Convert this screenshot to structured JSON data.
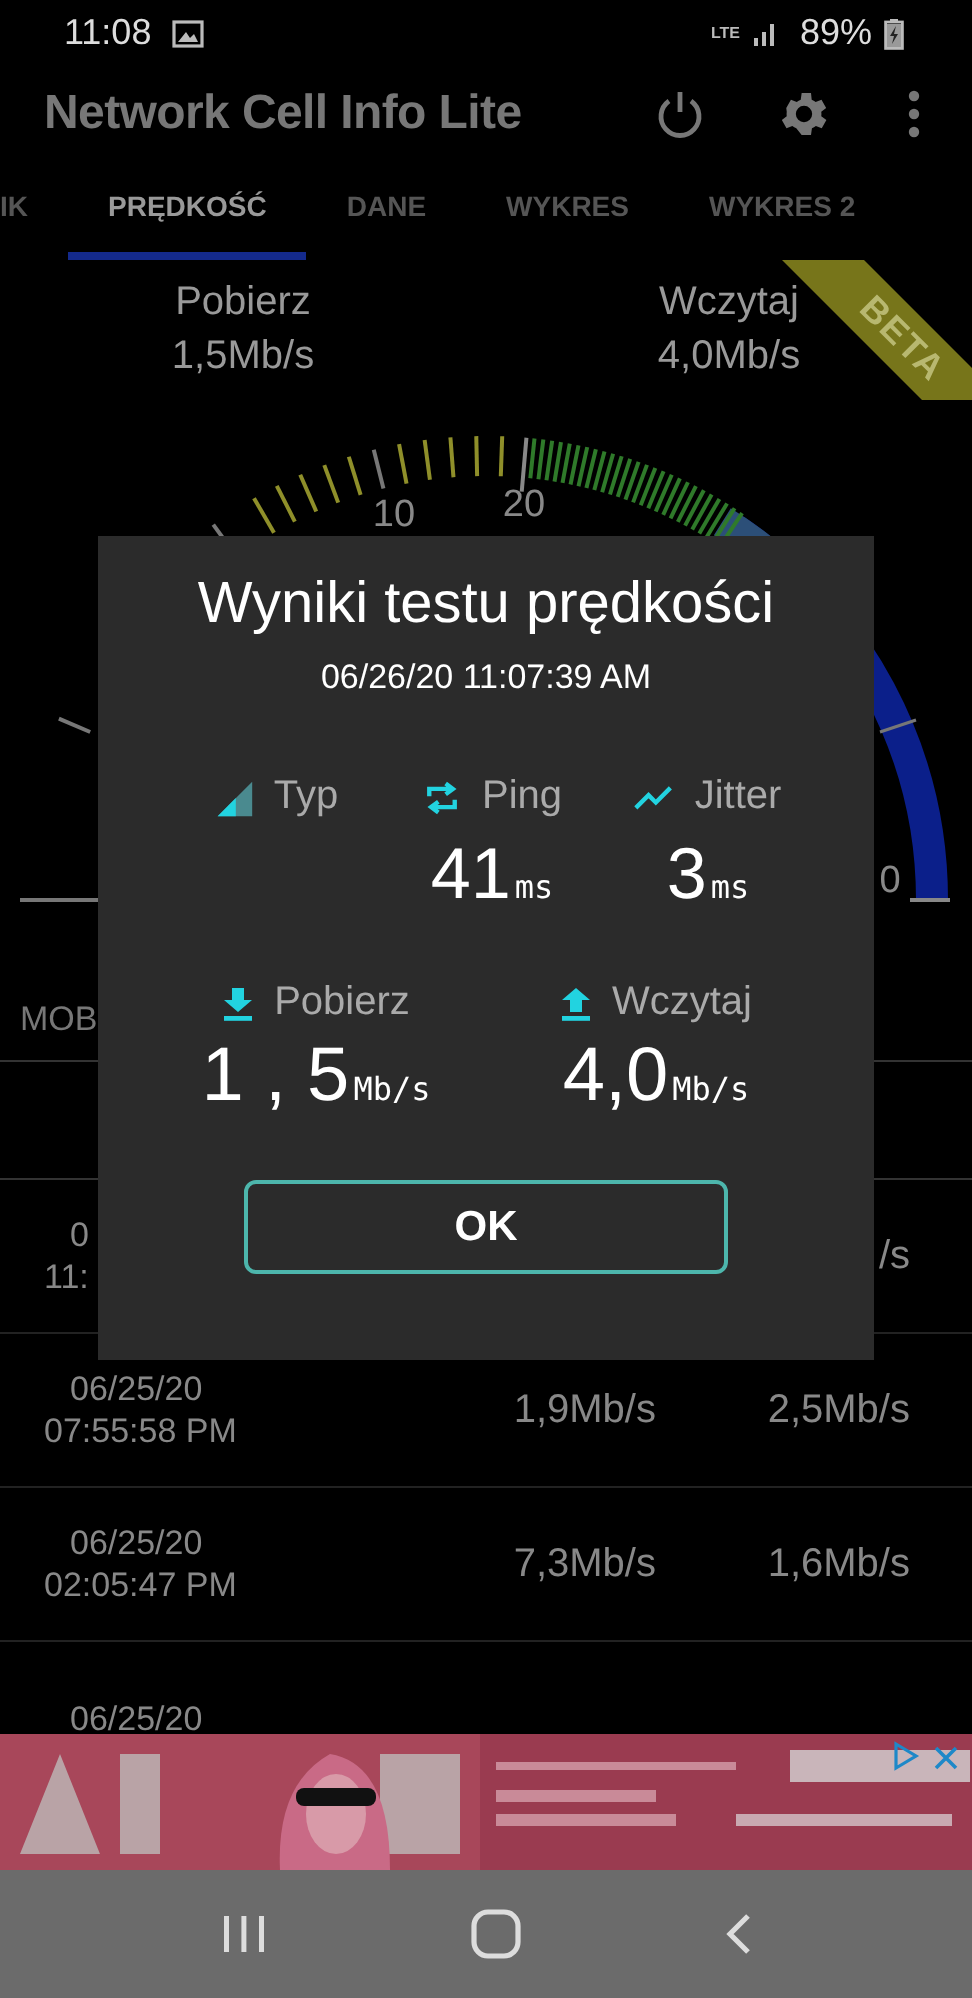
{
  "status_bar": {
    "time": "11:08",
    "network": "LTE",
    "battery": "89%"
  },
  "app_bar": {
    "title": "Network Cell Info Lite"
  },
  "tabs": [
    {
      "label": "IK",
      "selected": false
    },
    {
      "label": "PRĘDKOŚĆ",
      "selected": true
    },
    {
      "label": "DANE",
      "selected": false
    },
    {
      "label": "WYKRES",
      "selected": false
    },
    {
      "label": "WYKRES 2",
      "selected": false
    }
  ],
  "summary": {
    "ribbon": "BETA",
    "items": [
      {
        "label": "Pobierz",
        "value": "1,5Mb/s"
      },
      {
        "label": "Wczytaj",
        "value": "4,0Mb/s"
      }
    ]
  },
  "gauge": {
    "labels": [
      "10",
      "20",
      "0"
    ]
  },
  "section_label": "MOB",
  "history": {
    "rows": [
      {
        "date": "0",
        "time": "11:",
        "upload": "/s"
      },
      {
        "date": "06/25/20",
        "time": "07:55:58 PM",
        "download": "1,9Mb/s",
        "upload": "2,5Mb/s"
      },
      {
        "date": "06/25/20",
        "time": "02:05:47 PM",
        "download": "7,3Mb/s",
        "upload": "1,6Mb/s"
      },
      {
        "date": "06/25/20"
      }
    ]
  },
  "dialog": {
    "title": "Wyniki testu prędkości",
    "timestamp": "06/26/20 11:07:39 AM",
    "metrics": [
      {
        "kind": "network-type",
        "label": "Typ"
      },
      {
        "kind": "ping",
        "label": "Ping",
        "value": "41",
        "unit": "ms"
      },
      {
        "kind": "jitter",
        "label": "Jitter",
        "value": "3",
        "unit": "ms"
      }
    ],
    "speeds": [
      {
        "kind": "download",
        "label": "Pobierz",
        "value": "1 , 5",
        "unit": "Mb/s"
      },
      {
        "kind": "upload",
        "label": "Wczytaj",
        "value": "4,0",
        "unit": "Mb/s"
      }
    ],
    "button": "OK"
  }
}
